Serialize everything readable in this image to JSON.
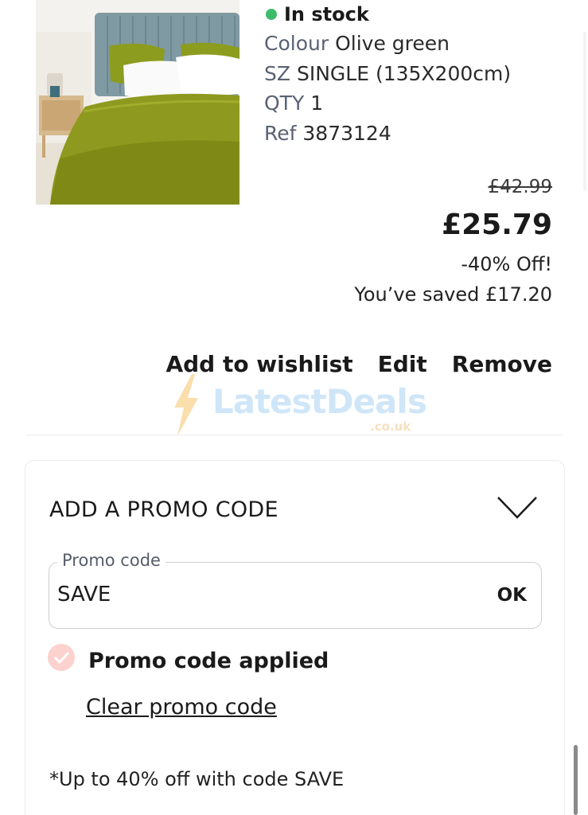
{
  "product": {
    "image_alt": "Olive green duvet set on a bed with a grey-blue upholstered headboard",
    "stock_status": "In stock",
    "colour_label": "Colour",
    "colour_value": "Olive green",
    "size_label": "SZ",
    "size_value": "SINGLE (135X200cm)",
    "qty_label": "QTY",
    "qty_value": "1",
    "ref_label": "Ref",
    "ref_value": "3873124"
  },
  "pricing": {
    "old_price": "£42.99",
    "new_price": "£25.79",
    "discount": "-40% Off!",
    "saved": "You’ve saved £17.20"
  },
  "actions": {
    "wishlist": "Add to wishlist",
    "edit": "Edit",
    "remove": "Remove"
  },
  "watermark": {
    "name": "LatestDeals",
    "domain": ".co.uk"
  },
  "promo": {
    "title": "ADD A PROMO CODE",
    "field_label": "Promo code",
    "field_value": "SAVE",
    "ok_label": "OK",
    "applied_text": "Promo code applied",
    "clear_label": "Clear promo code",
    "footnote": "*Up to 40% off with code SAVE"
  },
  "colors": {
    "stock_green": "#3dbb6b",
    "applied_badge": "#fbd2cd",
    "olive": "#8e9a1f"
  },
  "icons": {
    "stock": "status-dot-icon",
    "chevron": "chevron-down-icon",
    "applied": "check-circle-icon",
    "watermark": "lightning-bolt-icon"
  }
}
